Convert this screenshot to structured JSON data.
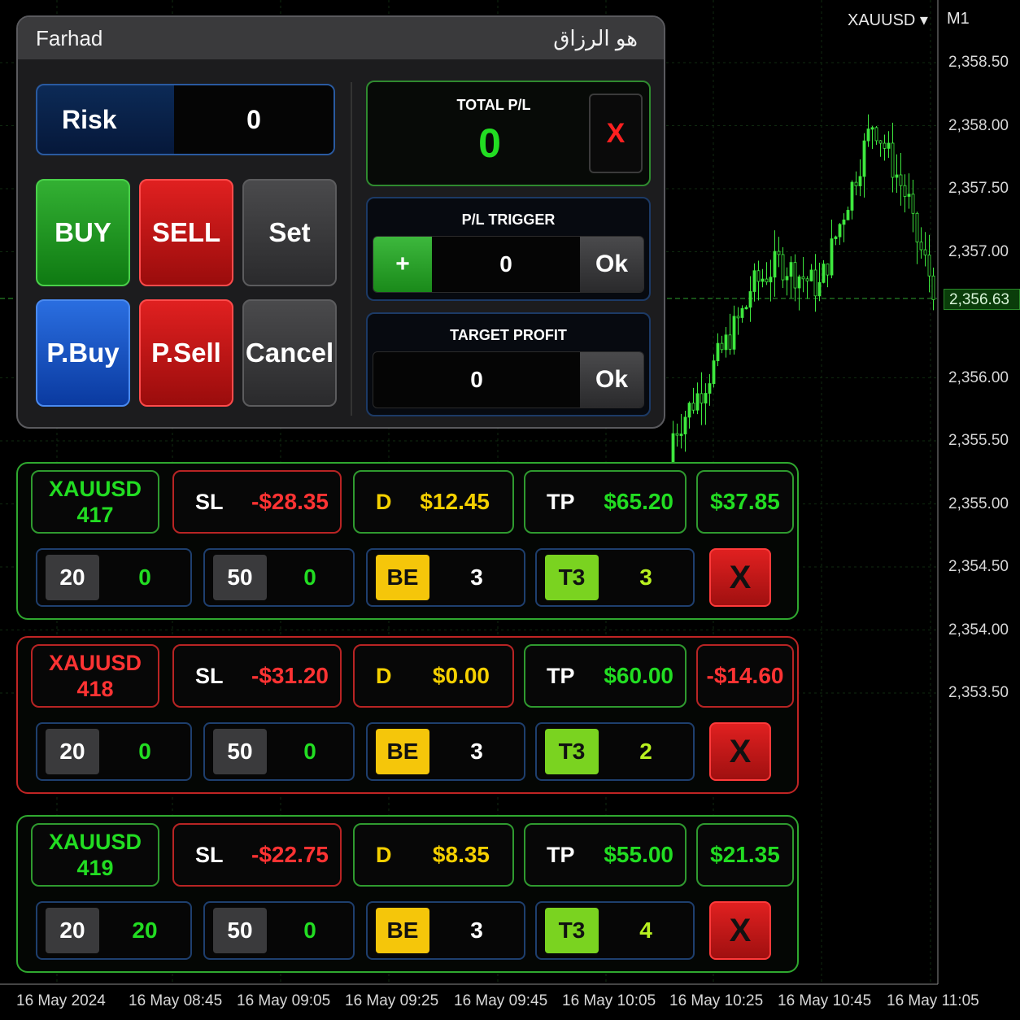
{
  "chart": {
    "symbol": "XAUUSD",
    "timeframe": "M1",
    "current_price": "2,356.63",
    "price_labels": [
      {
        "text": "2,358.50",
        "price": 2358.5
      },
      {
        "text": "2,358.00",
        "price": 2358.0
      },
      {
        "text": "2,357.50",
        "price": 2357.5
      },
      {
        "text": "2,357.00",
        "price": 2357.0
      },
      {
        "text": "2,356.00",
        "price": 2356.0
      },
      {
        "text": "2,355.50",
        "price": 2355.5
      },
      {
        "text": "2,355.00",
        "price": 2355.0
      },
      {
        "text": "2,354.50",
        "price": 2354.5
      },
      {
        "text": "2,354.00",
        "price": 2354.0
      },
      {
        "text": "2,353.50",
        "price": 2353.5
      }
    ],
    "time_labels": [
      "16 May 2024",
      "16 May 08:45",
      "16 May 09:05",
      "16 May 09:25",
      "16 May 09:45",
      "16 May 10:05",
      "16 May 10:25",
      "16 May 10:45",
      "16 May 11:05"
    ],
    "colors": {
      "candle": "#3ee83e",
      "grid": "#0f2a0f"
    }
  },
  "panel": {
    "title_left": "Farhad",
    "title_right": "هو الرزاق",
    "risk_label": "Risk",
    "risk_value": "0",
    "buy": "BUY",
    "sell": "SELL",
    "set": "Set",
    "pbuy": "P.Buy",
    "psell": "P.Sell",
    "cancel": "Cancel",
    "total_pl_label": "TOTAL P/L",
    "total_pl_value": "0",
    "close_all": "X",
    "pl_trigger_label": "P/L TRIGGER",
    "pl_trigger_plus": "+",
    "pl_trigger_value": "0",
    "ok": "Ok",
    "target_profit_label": "TARGET PROFIT",
    "target_profit_value": "0"
  },
  "trades": [
    {
      "symbol": "XAUUSD",
      "ticket": "417",
      "state": "profit",
      "sl_label": "SL",
      "sl": "-$28.35",
      "d_label": "D",
      "d": "$12.45",
      "tp_label": "TP",
      "tp": "$65.20",
      "net": "$37.85",
      "p1": "20",
      "p1v": "0",
      "p2": "50",
      "p2v": "0",
      "be": "BE",
      "bev": "3",
      "t3": "T3",
      "t3v": "3",
      "close": "X"
    },
    {
      "symbol": "XAUUSD",
      "ticket": "418",
      "state": "loss",
      "sl_label": "SL",
      "sl": "-$31.20",
      "d_label": "D",
      "d": "$0.00",
      "tp_label": "TP",
      "tp": "$60.00",
      "net": "-$14.60",
      "p1": "20",
      "p1v": "0",
      "p2": "50",
      "p2v": "0",
      "be": "BE",
      "bev": "3",
      "t3": "T3",
      "t3v": "2",
      "close": "X"
    },
    {
      "symbol": "XAUUSD",
      "ticket": "419",
      "state": "profit",
      "sl_label": "SL",
      "sl": "-$22.75",
      "d_label": "D",
      "d": "$8.35",
      "tp_label": "TP",
      "tp": "$55.00",
      "net": "$21.35",
      "p1": "20",
      "p1v": "20",
      "p2": "50",
      "p2v": "0",
      "be": "BE",
      "bev": "3",
      "t3": "T3",
      "t3v": "4",
      "close": "X"
    }
  ]
}
